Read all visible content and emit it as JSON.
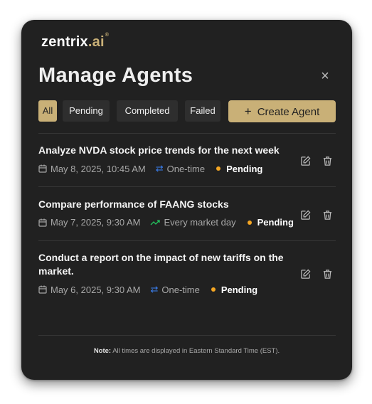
{
  "brand": {
    "name_main": "zentrix",
    "name_accent": ".ai",
    "mark": "®"
  },
  "header": {
    "title": "Manage Agents",
    "close_symbol": "×"
  },
  "filters": [
    {
      "label": "All",
      "active": true
    },
    {
      "label": "Pending",
      "active": false
    },
    {
      "label": "Completed",
      "active": false
    },
    {
      "label": "Failed",
      "active": false
    }
  ],
  "create_button": {
    "plus": "+",
    "label": "Create Agent"
  },
  "agents": [
    {
      "title": "Analyze NVDA stock price trends for the next week",
      "date": "May 8, 2025, 10:45 AM",
      "schedule": "One-time",
      "schedule_icon": "repeat-icon",
      "status": "Pending"
    },
    {
      "title": "Compare performance of FAANG stocks",
      "date": "May 7, 2025, 9:30 AM",
      "schedule": "Every market day",
      "schedule_icon": "trend-icon",
      "status": "Pending"
    },
    {
      "title": "Conduct a report on the impact of new tariffs on the market.",
      "date": "May 6, 2025, 9:30 AM",
      "schedule": "One-time",
      "schedule_icon": "repeat-icon",
      "status": "Pending"
    }
  ],
  "footer": {
    "note_label": "Note:",
    "note_text": " All times are displayed in Eastern Standard Time (EST)."
  },
  "colors": {
    "accent": "#c9b077",
    "panel": "#212121",
    "pending_dot": "#f5a623",
    "one_time_icon": "#3b82f6",
    "recurring_icon": "#22c55e"
  }
}
